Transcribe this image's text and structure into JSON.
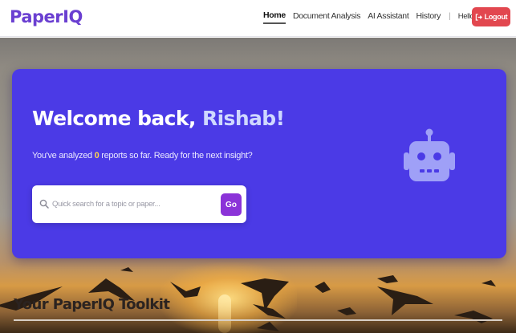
{
  "colors": {
    "brand": "#6a3fd1",
    "card": "#4b3ae6",
    "logout": "#e2474f",
    "go_button": "#8b33d8",
    "robot": "#9fa0f7",
    "accent_name": "#cfd8ff"
  },
  "header": {
    "brand": "PaperIQ",
    "nav": [
      "Home",
      "Document Analysis",
      "AI Assistant",
      "History"
    ],
    "active": "Home",
    "separator": "|",
    "greeting": "Hello, Rishab!",
    "logout_label": "Logout",
    "logout_icon": "logout-icon"
  },
  "welcome": {
    "title_prefix": "Welcome back,",
    "name": "Rishab!",
    "sub_before": "You've analyzed",
    "report_count": "0",
    "sub_after": "reports so far. Ready for the next insight?",
    "search_icon": "search-icon",
    "search_placeholder": "Quick search for a topic or paper...",
    "go_label": "Go",
    "illustration_icon": "robot-icon"
  },
  "toolkit": {
    "title": "Your PaperIQ Toolkit"
  }
}
